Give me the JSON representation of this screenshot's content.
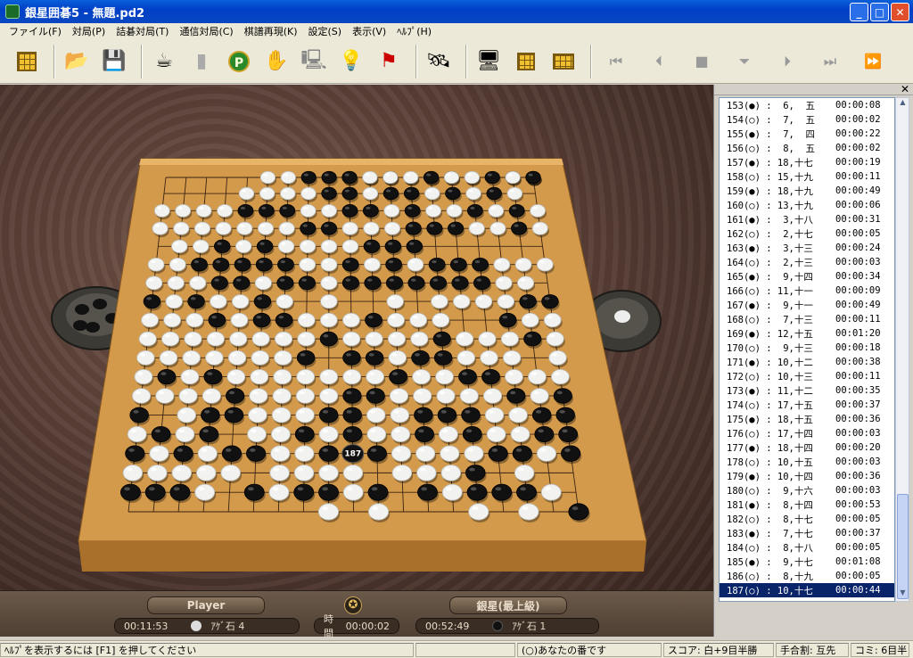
{
  "window": {
    "title": "銀星囲碁5 - 無題.pd2",
    "minimize": "_",
    "maximize": "□",
    "close": "✕"
  },
  "menu": [
    "ファイル(F)",
    "対局(P)",
    "詰碁対局(T)",
    "通信対局(C)",
    "棋譜再現(K)",
    "設定(S)",
    "表示(V)",
    "ﾍﾙﾌﾟ(H)"
  ],
  "toolbar": {
    "icons": [
      "board-icon",
      "open-folder-icon",
      "save-disk-icon",
      "coffee-cup-icon",
      "stone-box-icon",
      "pass-icon",
      "resign-hand-icon",
      "hint-computer-icon",
      "lightbulb-hint-icon",
      "flag-icon",
      "satellite-icon",
      "monitor-icon",
      "board-setup-icon",
      "board-grid-icon",
      "first-move-icon",
      "prev-move-icon",
      "stop-icon",
      "back-move-icon",
      "next-move-icon",
      "next-fast-icon",
      "last-move-icon"
    ]
  },
  "board": {
    "last_move_number": "187",
    "black_stones": [
      [
        10,
        3
      ],
      [
        14,
        3
      ],
      [
        15,
        3
      ],
      [
        12,
        3
      ],
      [
        17,
        3
      ],
      [
        19,
        3
      ],
      [
        20,
        4
      ],
      [
        9,
        4
      ],
      [
        10,
        4
      ],
      [
        14,
        4
      ],
      [
        19,
        4
      ],
      [
        18,
        4
      ],
      [
        17,
        5
      ],
      [
        8,
        4
      ],
      [
        10,
        5
      ],
      [
        15,
        5
      ],
      [
        13,
        5
      ],
      [
        12,
        5
      ],
      [
        9,
        5
      ],
      [
        5,
        6
      ],
      [
        6,
        6
      ],
      [
        7,
        6
      ],
      [
        10,
        6
      ],
      [
        11,
        6
      ],
      [
        13,
        6
      ],
      [
        16,
        6
      ],
      [
        18,
        6
      ],
      [
        8,
        7
      ],
      [
        9,
        7
      ],
      [
        13,
        7
      ],
      [
        14,
        7
      ],
      [
        15,
        7
      ],
      [
        18,
        7
      ],
      [
        4,
        8
      ],
      [
        6,
        8
      ],
      [
        11,
        8
      ],
      [
        12,
        8
      ],
      [
        13,
        8
      ],
      [
        3,
        9
      ],
      [
        4,
        9
      ],
      [
        5,
        9
      ],
      [
        6,
        9
      ],
      [
        7,
        9
      ],
      [
        10,
        9
      ],
      [
        12,
        9
      ],
      [
        14,
        9
      ],
      [
        15,
        9
      ],
      [
        16,
        9
      ],
      [
        4,
        10
      ],
      [
        5,
        10
      ],
      [
        7,
        10
      ],
      [
        8,
        10
      ],
      [
        10,
        10
      ],
      [
        11,
        10
      ],
      [
        12,
        10
      ],
      [
        13,
        10
      ],
      [
        14,
        10
      ],
      [
        15,
        10
      ],
      [
        16,
        10
      ],
      [
        1,
        11
      ],
      [
        3,
        11
      ],
      [
        6,
        11
      ],
      [
        18,
        11
      ],
      [
        19,
        11
      ],
      [
        4,
        12
      ],
      [
        6,
        12
      ],
      [
        7,
        12
      ],
      [
        11,
        12
      ],
      [
        17,
        12
      ],
      [
        9,
        13
      ],
      [
        14,
        13
      ],
      [
        18,
        13
      ],
      [
        8,
        14
      ],
      [
        10,
        14
      ],
      [
        11,
        14
      ],
      [
        13,
        14
      ],
      [
        14,
        14
      ],
      [
        2,
        15
      ],
      [
        4,
        15
      ],
      [
        12,
        15
      ],
      [
        15,
        15
      ],
      [
        16,
        15
      ],
      [
        5,
        16
      ],
      [
        10,
        16
      ],
      [
        11,
        16
      ],
      [
        17,
        16
      ],
      [
        19,
        16
      ],
      [
        1,
        17
      ],
      [
        4,
        17
      ],
      [
        5,
        17
      ],
      [
        9,
        17
      ],
      [
        10,
        17
      ],
      [
        13,
        17
      ],
      [
        14,
        17
      ],
      [
        15,
        17
      ],
      [
        18,
        17
      ],
      [
        19,
        17
      ],
      [
        2,
        18
      ],
      [
        4,
        18
      ],
      [
        8,
        18
      ],
      [
        10,
        18
      ],
      [
        13,
        18
      ],
      [
        15,
        18
      ],
      [
        18,
        18
      ],
      [
        19,
        18
      ],
      [
        1,
        19
      ],
      [
        3,
        19
      ],
      [
        5,
        19
      ],
      [
        6,
        19
      ],
      [
        9,
        19
      ],
      [
        10,
        19
      ],
      [
        11,
        19
      ],
      [
        16,
        19
      ],
      [
        17,
        19
      ],
      [
        19,
        19
      ],
      [
        15,
        20
      ],
      [
        1,
        21
      ],
      [
        2,
        21
      ],
      [
        3,
        21
      ],
      [
        6,
        21
      ],
      [
        8,
        21
      ],
      [
        9,
        21
      ],
      [
        11,
        21
      ],
      [
        13,
        21
      ],
      [
        15,
        21
      ],
      [
        16,
        21
      ],
      [
        17,
        21
      ],
      [
        19,
        22
      ]
    ],
    "white_stones": [
      [
        11,
        3
      ],
      [
        12,
        3
      ],
      [
        13,
        3
      ],
      [
        16,
        3
      ],
      [
        18,
        3
      ],
      [
        6,
        4
      ],
      [
        7,
        4
      ],
      [
        11,
        4
      ],
      [
        12,
        4
      ],
      [
        13,
        4
      ],
      [
        15,
        4
      ],
      [
        16,
        4
      ],
      [
        5,
        5
      ],
      [
        6,
        5
      ],
      [
        7,
        5
      ],
      [
        8,
        5
      ],
      [
        11,
        5
      ],
      [
        14,
        5
      ],
      [
        16,
        5
      ],
      [
        18,
        5
      ],
      [
        1,
        6
      ],
      [
        2,
        6
      ],
      [
        3,
        6
      ],
      [
        4,
        6
      ],
      [
        8,
        6
      ],
      [
        9,
        6
      ],
      [
        12,
        6
      ],
      [
        14,
        6
      ],
      [
        15,
        6
      ],
      [
        17,
        6
      ],
      [
        19,
        6
      ],
      [
        1,
        7
      ],
      [
        2,
        7
      ],
      [
        3,
        7
      ],
      [
        4,
        7
      ],
      [
        5,
        7
      ],
      [
        6,
        7
      ],
      [
        7,
        7
      ],
      [
        10,
        7
      ],
      [
        11,
        7
      ],
      [
        12,
        7
      ],
      [
        16,
        7
      ],
      [
        17,
        7
      ],
      [
        19,
        7
      ],
      [
        2,
        8
      ],
      [
        3,
        8
      ],
      [
        5,
        8
      ],
      [
        7,
        8
      ],
      [
        8,
        8
      ],
      [
        9,
        8
      ],
      [
        10,
        8
      ],
      [
        1,
        9
      ],
      [
        2,
        9
      ],
      [
        8,
        9
      ],
      [
        9,
        9
      ],
      [
        11,
        9
      ],
      [
        13,
        9
      ],
      [
        17,
        9
      ],
      [
        18,
        9
      ],
      [
        19,
        9
      ],
      [
        1,
        10
      ],
      [
        2,
        10
      ],
      [
        3,
        10
      ],
      [
        6,
        10
      ],
      [
        9,
        10
      ],
      [
        17,
        10
      ],
      [
        18,
        10
      ],
      [
        2,
        11
      ],
      [
        4,
        11
      ],
      [
        5,
        11
      ],
      [
        7,
        11
      ],
      [
        9,
        11
      ],
      [
        12,
        11
      ],
      [
        14,
        11
      ],
      [
        15,
        11
      ],
      [
        16,
        11
      ],
      [
        17,
        11
      ],
      [
        1,
        12
      ],
      [
        2,
        12
      ],
      [
        3,
        12
      ],
      [
        5,
        12
      ],
      [
        8,
        12
      ],
      [
        9,
        12
      ],
      [
        10,
        12
      ],
      [
        12,
        12
      ],
      [
        13,
        12
      ],
      [
        14,
        12
      ],
      [
        18,
        12
      ],
      [
        19,
        12
      ],
      [
        1,
        13
      ],
      [
        2,
        13
      ],
      [
        3,
        13
      ],
      [
        4,
        13
      ],
      [
        5,
        13
      ],
      [
        6,
        13
      ],
      [
        7,
        13
      ],
      [
        8,
        13
      ],
      [
        10,
        13
      ],
      [
        11,
        13
      ],
      [
        12,
        13
      ],
      [
        13,
        13
      ],
      [
        15,
        13
      ],
      [
        16,
        13
      ],
      [
        17,
        13
      ],
      [
        19,
        13
      ],
      [
        1,
        14
      ],
      [
        2,
        14
      ],
      [
        3,
        14
      ],
      [
        4,
        14
      ],
      [
        5,
        14
      ],
      [
        6,
        14
      ],
      [
        7,
        14
      ],
      [
        12,
        14
      ],
      [
        15,
        14
      ],
      [
        16,
        14
      ],
      [
        17,
        14
      ],
      [
        19,
        14
      ],
      [
        1,
        15
      ],
      [
        3,
        15
      ],
      [
        5,
        15
      ],
      [
        6,
        15
      ],
      [
        7,
        15
      ],
      [
        8,
        15
      ],
      [
        9,
        15
      ],
      [
        10,
        15
      ],
      [
        11,
        15
      ],
      [
        13,
        15
      ],
      [
        14,
        15
      ],
      [
        17,
        15
      ],
      [
        18,
        15
      ],
      [
        19,
        15
      ],
      [
        1,
        16
      ],
      [
        2,
        16
      ],
      [
        3,
        16
      ],
      [
        4,
        16
      ],
      [
        6,
        16
      ],
      [
        7,
        16
      ],
      [
        8,
        16
      ],
      [
        9,
        16
      ],
      [
        12,
        16
      ],
      [
        13,
        16
      ],
      [
        14,
        16
      ],
      [
        15,
        16
      ],
      [
        16,
        16
      ],
      [
        18,
        16
      ],
      [
        3,
        17
      ],
      [
        6,
        17
      ],
      [
        7,
        17
      ],
      [
        8,
        17
      ],
      [
        11,
        17
      ],
      [
        12,
        17
      ],
      [
        16,
        17
      ],
      [
        17,
        17
      ],
      [
        1,
        18
      ],
      [
        3,
        18
      ],
      [
        6,
        18
      ],
      [
        7,
        18
      ],
      [
        9,
        18
      ],
      [
        11,
        18
      ],
      [
        12,
        18
      ],
      [
        14,
        18
      ],
      [
        16,
        18
      ],
      [
        17,
        18
      ],
      [
        18,
        18
      ],
      [
        2,
        19
      ],
      [
        4,
        19
      ],
      [
        7,
        19
      ],
      [
        8,
        19
      ],
      [
        12,
        19
      ],
      [
        13,
        19
      ],
      [
        14,
        19
      ],
      [
        15,
        19
      ],
      [
        18,
        19
      ],
      [
        1,
        20
      ],
      [
        2,
        20
      ],
      [
        3,
        20
      ],
      [
        4,
        20
      ],
      [
        5,
        20
      ],
      [
        7,
        20
      ],
      [
        8,
        20
      ],
      [
        9,
        20
      ],
      [
        10,
        20
      ],
      [
        12,
        20
      ],
      [
        13,
        20
      ],
      [
        14,
        20
      ],
      [
        17,
        20
      ],
      [
        4,
        21
      ],
      [
        7,
        21
      ],
      [
        10,
        21
      ],
      [
        14,
        21
      ],
      [
        18,
        21
      ],
      [
        9,
        22
      ],
      [
        11,
        22
      ],
      [
        15,
        22
      ],
      [
        17,
        22
      ]
    ]
  },
  "players": {
    "left_name": "Player",
    "right_name": "銀星(最上級)",
    "left_time": "00:11:53",
    "right_time": "00:52:49",
    "left_captures_label": "ｱｹﾞ石",
    "left_captures": "4",
    "right_captures_label": "ｱｹﾞ石",
    "right_captures": "1",
    "time_label": "時間",
    "time_value": "00:00:02"
  },
  "moves": [
    {
      "m": "153(●) :  6,  五",
      "t": "00:00:08"
    },
    {
      "m": "154(○) :  7,  五",
      "t": "00:00:02"
    },
    {
      "m": "155(●) :  7,  四",
      "t": "00:00:22"
    },
    {
      "m": "156(○) :  8,  五",
      "t": "00:00:02"
    },
    {
      "m": "157(●) : 18,十七",
      "t": "00:00:19"
    },
    {
      "m": "158(○) : 15,十九",
      "t": "00:00:11"
    },
    {
      "m": "159(●) : 18,十九",
      "t": "00:00:49"
    },
    {
      "m": "160(○) : 13,十九",
      "t": "00:00:06"
    },
    {
      "m": "161(●) :  3,十八",
      "t": "00:00:31"
    },
    {
      "m": "162(○) :  2,十七",
      "t": "00:00:05"
    },
    {
      "m": "163(●) :  3,十三",
      "t": "00:00:24"
    },
    {
      "m": "164(○) :  2,十三",
      "t": "00:00:03"
    },
    {
      "m": "165(●) :  9,十四",
      "t": "00:00:34"
    },
    {
      "m": "166(○) : 11,十一",
      "t": "00:00:09"
    },
    {
      "m": "167(●) :  9,十一",
      "t": "00:00:49"
    },
    {
      "m": "168(○) :  7,十三",
      "t": "00:00:11"
    },
    {
      "m": "169(●) : 12,十五",
      "t": "00:01:20"
    },
    {
      "m": "170(○) :  9,十三",
      "t": "00:00:18"
    },
    {
      "m": "171(●) : 10,十二",
      "t": "00:00:38"
    },
    {
      "m": "172(○) : 10,十三",
      "t": "00:00:11"
    },
    {
      "m": "173(●) : 11,十二",
      "t": "00:00:35"
    },
    {
      "m": "174(○) : 17,十五",
      "t": "00:00:37"
    },
    {
      "m": "175(●) : 18,十五",
      "t": "00:00:36"
    },
    {
      "m": "176(○) : 17,十四",
      "t": "00:00:03"
    },
    {
      "m": "177(●) : 18,十四",
      "t": "00:00:20"
    },
    {
      "m": "178(○) : 10,十五",
      "t": "00:00:03"
    },
    {
      "m": "179(●) : 10,十四",
      "t": "00:00:36"
    },
    {
      "m": "180(○) :  9,十六",
      "t": "00:00:03"
    },
    {
      "m": "181(●) :  8,十四",
      "t": "00:00:53"
    },
    {
      "m": "182(○) :  8,十七",
      "t": "00:00:05"
    },
    {
      "m": "183(●) :  7,十七",
      "t": "00:00:37"
    },
    {
      "m": "184(○) :  8,十八",
      "t": "00:00:05"
    },
    {
      "m": "185(●) :  9,十七",
      "t": "00:01:08"
    },
    {
      "m": "186(○) :  8,十九",
      "t": "00:00:05"
    },
    {
      "m": "187(○) : 10,十七",
      "t": "00:00:44"
    }
  ],
  "status": {
    "help": "ﾍﾙﾌﾟを表示するには [F1] を押してください",
    "blank": "",
    "turn": "(○)あなたの番です",
    "score": "スコア: 白+9目半勝",
    "handicap": "手合割: 互先",
    "komi": "コミ: 6目半"
  }
}
